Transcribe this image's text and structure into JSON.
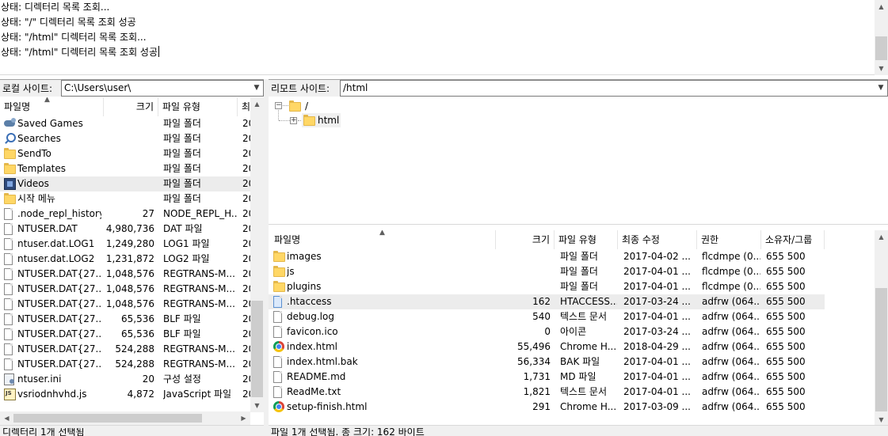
{
  "log": {
    "lines": [
      "상태: 디렉터리 목록 조회...",
      "상태: \"/\" 디렉터리 목록 조회 성공",
      "상태: \"/html\" 디렉터리 목록 조회...",
      "상태: \"/html\" 디렉터리 목록 조회 성공"
    ]
  },
  "local": {
    "site_label": "로컬 사이트:",
    "path": "C:\\Users\\user\\",
    "columns": {
      "name": "파일명",
      "size": "크기",
      "type": "파일 유형",
      "modified": "최"
    },
    "files": [
      {
        "name": "Saved Games",
        "size": "",
        "type": "파일 폴더",
        "mod": "20",
        "icon": "games-icon"
      },
      {
        "name": "Searches",
        "size": "",
        "type": "파일 폴더",
        "mod": "20",
        "icon": "search-icon"
      },
      {
        "name": "SendTo",
        "size": "",
        "type": "파일 폴더",
        "mod": "20",
        "icon": "folder-icon"
      },
      {
        "name": "Templates",
        "size": "",
        "type": "파일 폴더",
        "mod": "20",
        "icon": "folder-icon"
      },
      {
        "name": "Videos",
        "size": "",
        "type": "파일 폴더",
        "mod": "20",
        "icon": "video-folder-icon"
      },
      {
        "name": "시작 메뉴",
        "size": "",
        "type": "파일 폴더",
        "mod": "20",
        "icon": "folder-icon"
      },
      {
        "name": ".node_repl_history",
        "size": "27",
        "type": "NODE_REPL_H...",
        "mod": "20",
        "icon": "file-icon"
      },
      {
        "name": "NTUSER.DAT",
        "size": "4,980,736",
        "type": "DAT 파일",
        "mod": "20",
        "icon": "file-icon"
      },
      {
        "name": "ntuser.dat.LOG1",
        "size": "1,249,280",
        "type": "LOG1 파일",
        "mod": "20",
        "icon": "file-icon"
      },
      {
        "name": "ntuser.dat.LOG2",
        "size": "1,231,872",
        "type": "LOG2 파일",
        "mod": "20",
        "icon": "file-icon"
      },
      {
        "name": "NTUSER.DAT{27...",
        "size": "1,048,576",
        "type": "REGTRANS-M...",
        "mod": "20",
        "icon": "file-icon"
      },
      {
        "name": "NTUSER.DAT{27...",
        "size": "1,048,576",
        "type": "REGTRANS-M...",
        "mod": "20",
        "icon": "file-icon"
      },
      {
        "name": "NTUSER.DAT{27...",
        "size": "1,048,576",
        "type": "REGTRANS-M...",
        "mod": "20",
        "icon": "file-icon"
      },
      {
        "name": "NTUSER.DAT{27...",
        "size": "65,536",
        "type": "BLF 파일",
        "mod": "20",
        "icon": "file-icon"
      },
      {
        "name": "NTUSER.DAT{27...",
        "size": "65,536",
        "type": "BLF 파일",
        "mod": "20",
        "icon": "file-icon"
      },
      {
        "name": "NTUSER.DAT{27...",
        "size": "524,288",
        "type": "REGTRANS-M...",
        "mod": "20",
        "icon": "file-icon"
      },
      {
        "name": "NTUSER.DAT{27...",
        "size": "524,288",
        "type": "REGTRANS-M...",
        "mod": "20",
        "icon": "file-icon"
      },
      {
        "name": "ntuser.ini",
        "size": "20",
        "type": "구성 설정",
        "mod": "20",
        "icon": "ini-icon"
      },
      {
        "name": "vsriodnhvhd.js",
        "size": "4,872",
        "type": "JavaScript 파일",
        "mod": "20",
        "icon": "js-icon"
      }
    ],
    "status": "디렉터리 1개 선택됨"
  },
  "remote": {
    "site_label": "리모트 사이트:",
    "path": "/html",
    "tree": [
      {
        "label": "/"
      },
      {
        "label": "html"
      }
    ],
    "columns": {
      "name": "파일명",
      "size": "크기",
      "type": "파일 유형",
      "modified": "최종 수정",
      "perm": "권한",
      "owner": "소유자/그룹"
    },
    "files": [
      {
        "name": "images",
        "size": "",
        "type": "파일 폴더",
        "mod": "2017-04-02 ...",
        "perm": "flcdmpe (0...",
        "owner": "655 500",
        "icon": "folder-icon"
      },
      {
        "name": "js",
        "size": "",
        "type": "파일 폴더",
        "mod": "2017-04-01 ...",
        "perm": "flcdmpe (0...",
        "owner": "655 500",
        "icon": "folder-icon"
      },
      {
        "name": "plugins",
        "size": "",
        "type": "파일 폴더",
        "mod": "2017-04-01 ...",
        "perm": "flcdmpe (0...",
        "owner": "655 500",
        "icon": "folder-icon"
      },
      {
        "name": ".htaccess",
        "size": "162",
        "type": "HTACCESS...",
        "mod": "2017-03-24 ...",
        "perm": "adfrw (064...",
        "owner": "655 500",
        "icon": "file-blue-icon"
      },
      {
        "name": "debug.log",
        "size": "540",
        "type": "텍스트 문서",
        "mod": "2017-04-01 ...",
        "perm": "adfrw (064...",
        "owner": "655 500",
        "icon": "file-icon"
      },
      {
        "name": "favicon.ico",
        "size": "0",
        "type": "아이콘",
        "mod": "2017-03-24 ...",
        "perm": "adfrw (064...",
        "owner": "655 500",
        "icon": "file-icon"
      },
      {
        "name": "index.html",
        "size": "55,496",
        "type": "Chrome H...",
        "mod": "2018-04-29 ...",
        "perm": "adfrw (064...",
        "owner": "655 500",
        "icon": "chrome-icon"
      },
      {
        "name": "index.html.bak",
        "size": "56,334",
        "type": "BAK 파일",
        "mod": "2017-04-01 ...",
        "perm": "adfrw (064...",
        "owner": "655 500",
        "icon": "file-icon"
      },
      {
        "name": "README.md",
        "size": "1,731",
        "type": "MD 파일",
        "mod": "2017-04-01 ...",
        "perm": "adfrw (064...",
        "owner": "655 500",
        "icon": "file-icon"
      },
      {
        "name": "ReadMe.txt",
        "size": "1,821",
        "type": "텍스트 문서",
        "mod": "2017-04-01 ...",
        "perm": "adfrw (064...",
        "owner": "655 500",
        "icon": "file-icon"
      },
      {
        "name": "setup-finish.html",
        "size": "291",
        "type": "Chrome H...",
        "mod": "2017-03-09 ...",
        "perm": "adfrw (064...",
        "owner": "655 500",
        "icon": "chrome-icon"
      }
    ],
    "status": "파일 1개 선택됨. 총 크기: 162 바이트"
  }
}
